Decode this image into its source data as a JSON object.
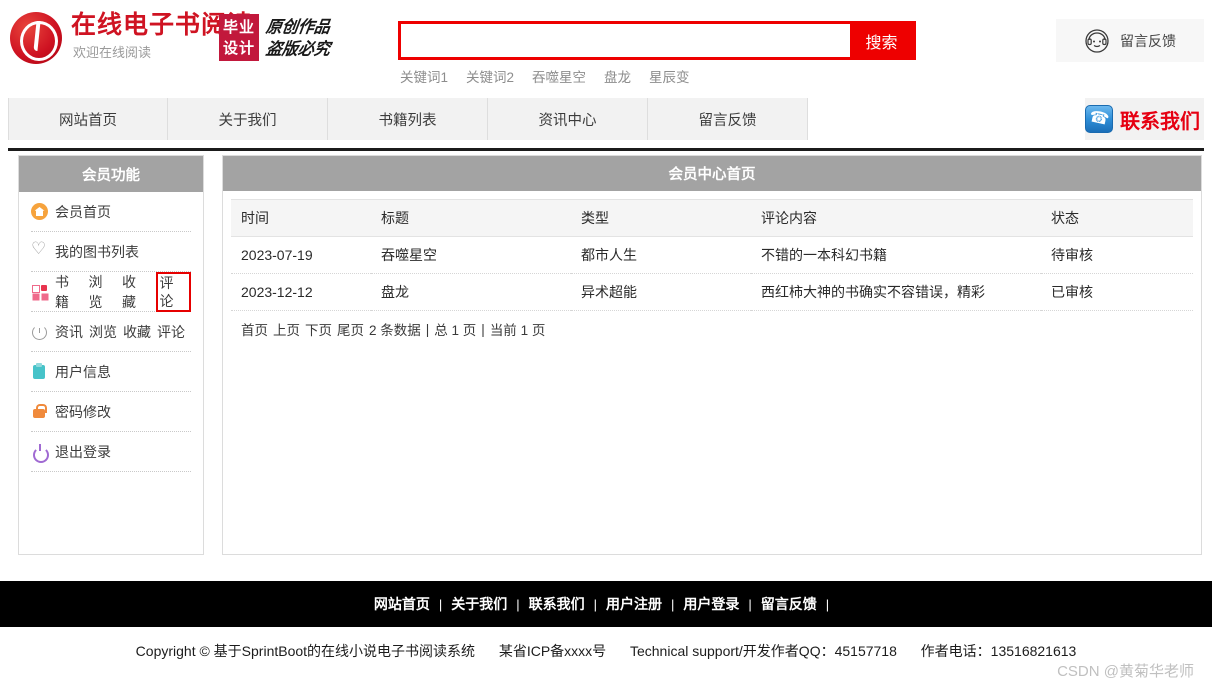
{
  "header": {
    "logo_title": "在线电子书阅读",
    "logo_subtitle": "欢迎在线阅读",
    "badge_line1": "毕业",
    "badge_line2": "设计",
    "calligraphy_line1": "原创作品",
    "calligraphy_line2": "盗版必究",
    "feedback_label": "留言反馈"
  },
  "search": {
    "value": "",
    "placeholder": "",
    "button_label": "搜索",
    "keywords": [
      "关键词1",
      "关键词2",
      "吞噬星空",
      "盘龙",
      "星辰变"
    ]
  },
  "nav": {
    "items": [
      "网站首页",
      "关于我们",
      "书籍列表",
      "资讯中心",
      "留言反馈"
    ],
    "contact_label": "联系我们"
  },
  "sidebar": {
    "title": "会员功能",
    "items": [
      {
        "icon": "home-icon",
        "labels": [
          "会员首页"
        ]
      },
      {
        "icon": "heart-icon",
        "labels": [
          "我的图书列表"
        ]
      },
      {
        "icon": "grid-icon",
        "labels": [
          "书籍",
          "浏览",
          "收藏",
          "评论"
        ],
        "highlight_index": 3
      },
      {
        "icon": "clock-icon",
        "labels": [
          "资讯",
          "浏览",
          "收藏",
          "评论"
        ]
      },
      {
        "icon": "clipboard-icon",
        "labels": [
          "用户信息"
        ]
      },
      {
        "icon": "lock-icon",
        "labels": [
          "密码修改"
        ]
      },
      {
        "icon": "power-icon",
        "labels": [
          "退出登录"
        ]
      }
    ]
  },
  "main": {
    "title": "会员中心首页",
    "table": {
      "columns": [
        "时间",
        "标题",
        "类型",
        "评论内容",
        "状态"
      ],
      "rows": [
        {
          "time": "2023-07-19",
          "title": "吞噬星空",
          "type": "都市人生",
          "comment": "不错的一本科幻书籍",
          "status": "待审核",
          "status_state": "pending"
        },
        {
          "time": "2023-12-12",
          "title": "盘龙",
          "type": "异术超能",
          "comment": "西红柿大神的书确实不容错误，精彩",
          "status": "已审核",
          "status_state": "done"
        }
      ]
    },
    "pager": {
      "first": "首页",
      "prev": "上页",
      "next": "下页",
      "last": "尾页",
      "total_records": "2 条数据",
      "sep1": "|",
      "total_pages": "总 1 页",
      "sep2": "|",
      "current_page": "当前 1 页"
    }
  },
  "footer": {
    "links": [
      "网站首页",
      "关于我们",
      "联系我们",
      "用户注册",
      "用户登录",
      "留言反馈"
    ],
    "copyright": "Copyright © 基于SprintBoot的在线小说电子书阅读系统",
    "icp": "某省ICP备xxxx号",
    "support": "Technical support/开发作者QQ：45157718",
    "phone": "作者电话：13516821613",
    "watermark": "CSDN @黄菊华老师"
  },
  "colors": {
    "brand_red": "#cf1322",
    "search_red": "#ee0000",
    "panel_gray": "#a3a3a3",
    "status_pending": "#e60000",
    "highlight_border": "#e60000"
  }
}
